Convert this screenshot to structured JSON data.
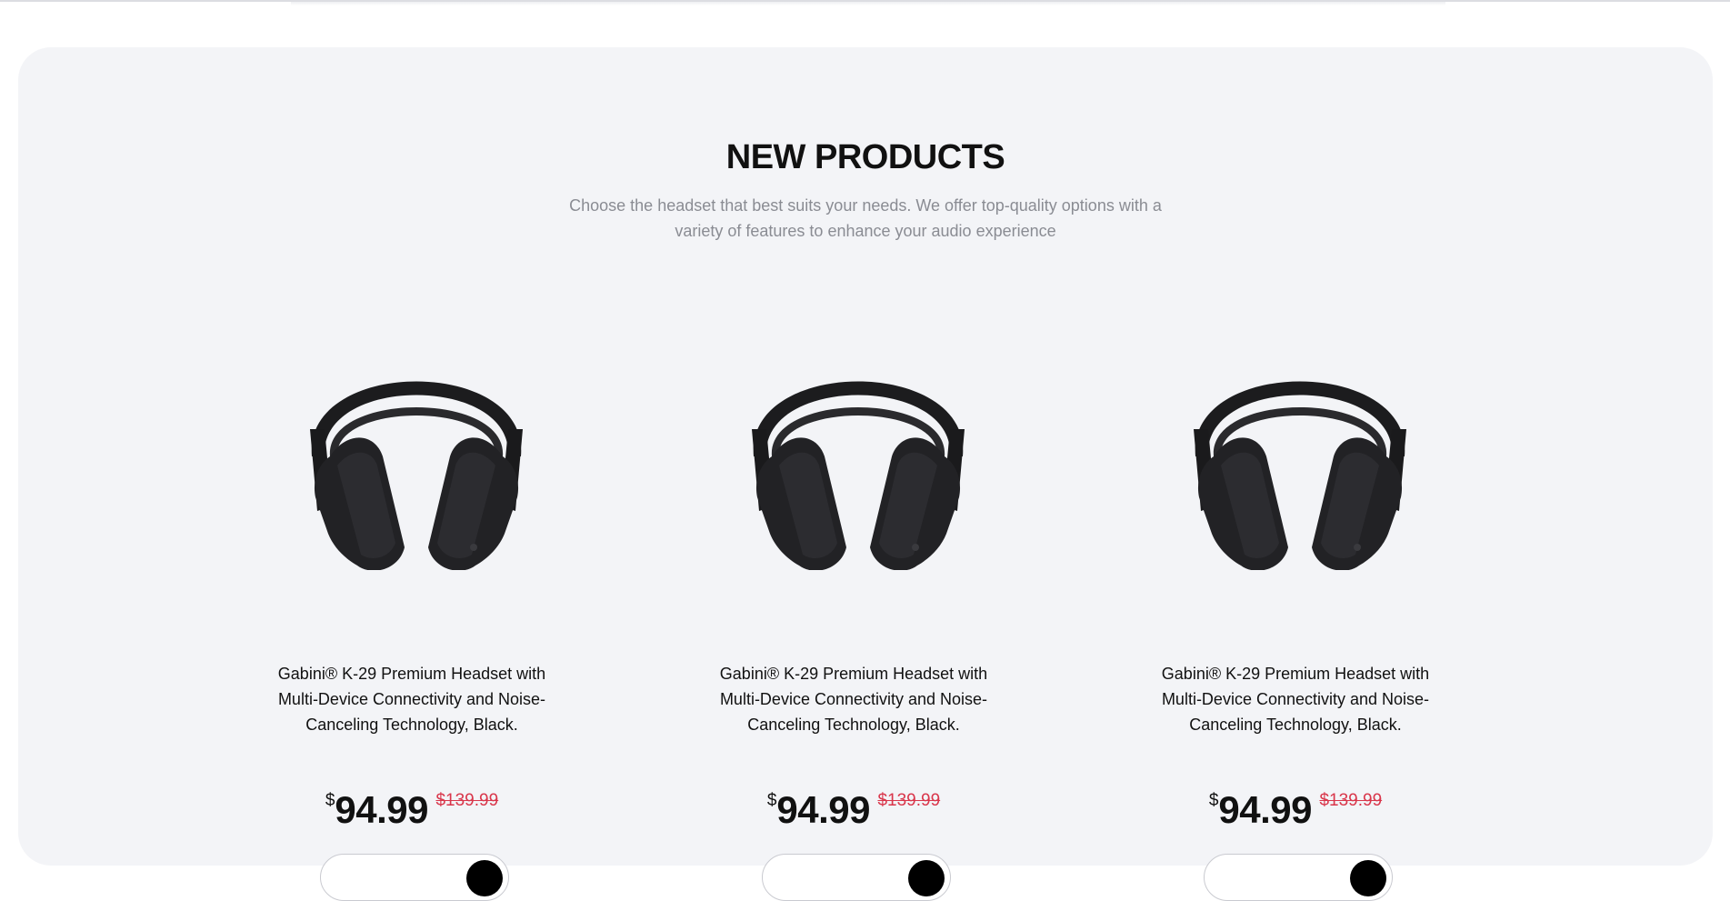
{
  "section": {
    "title": "NEW PRODUCTS",
    "subtitle": "Choose the headset that best suits your needs. We offer top-quality options with a variety of features to enhance your audio experience"
  },
  "products": [
    {
      "image_alt": "headphones-image",
      "title": "Gabini® K-29 Premium Headset with Multi-Device Connectivity and Noise-Canceling Technology, Black.",
      "currency": "$",
      "price": "94.99",
      "old_price": "$139.99",
      "button_label": ""
    },
    {
      "image_alt": "headphones-image",
      "title": "Gabini® K-29 Premium Headset with Multi-Device Connectivity and Noise-Canceling Technology, Black.",
      "currency": "$",
      "price": "94.99",
      "old_price": "$139.99",
      "button_label": ""
    },
    {
      "image_alt": "headphones-image",
      "title": "Gabini® K-29 Premium Headset with Multi-Device Connectivity and Noise-Canceling Technology, Black.",
      "currency": "$",
      "price": "94.99",
      "old_price": "$139.99",
      "button_label": ""
    }
  ],
  "colors": {
    "section_background": "#f3f4f7",
    "old_price": "#d9364b",
    "text": "#111111",
    "subtitle": "#8a8c93"
  }
}
